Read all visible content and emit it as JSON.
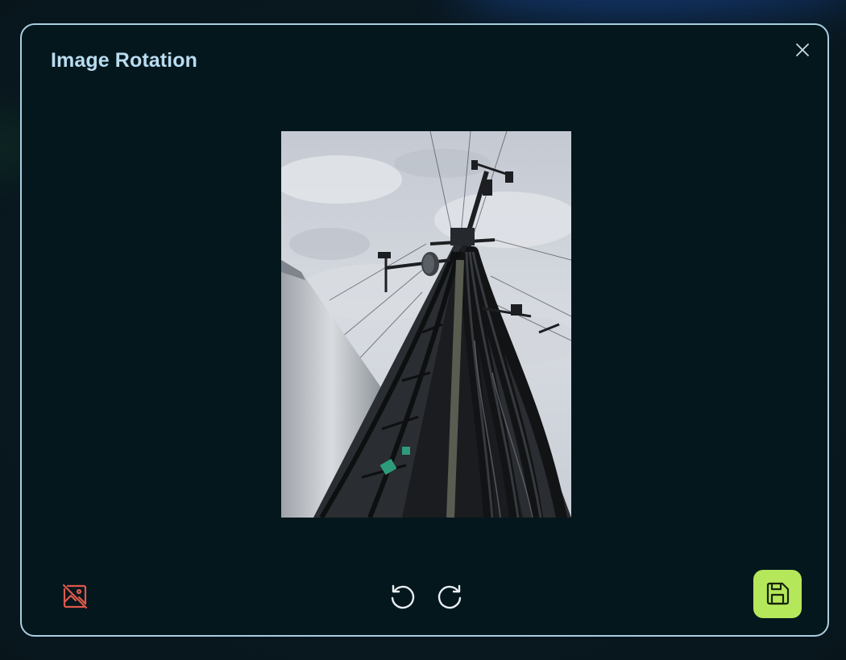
{
  "dialog": {
    "title": "Image Rotation"
  },
  "image": {
    "subject": "cell-tower-photo"
  },
  "icons": {
    "close": "close-icon",
    "remove_image": "image-off-icon",
    "rotate_left": "rotate-ccw-icon",
    "rotate_right": "rotate-cw-icon",
    "save": "save-icon"
  },
  "colors": {
    "title": "#b9dcf0",
    "modal_border": "#a9cfe0",
    "modal_bg": "#04171d",
    "remove_icon": "#e0584a",
    "save_button": "#b5e75a"
  }
}
